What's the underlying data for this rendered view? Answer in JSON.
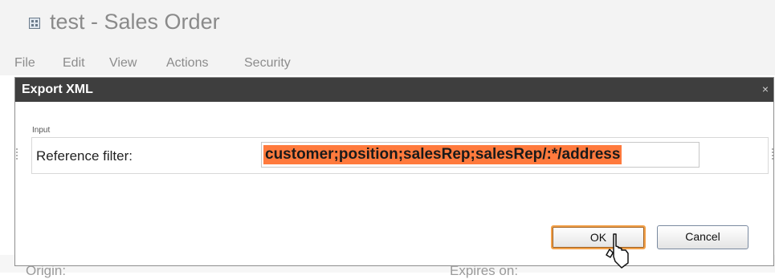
{
  "app": {
    "title": "test - Sales Order",
    "menu": [
      "File",
      "Edit",
      "View",
      "Actions",
      "Security"
    ],
    "background_labels": [
      "Origin:",
      "Expires on:"
    ]
  },
  "dialog": {
    "title": "Export XML",
    "close_glyph": "×",
    "group_label": "Input",
    "field_label": "Reference filter:",
    "field_value": "customer;position;salesRep;salesRep/:*/address",
    "ok_label": "OK",
    "cancel_label": "Cancel"
  },
  "colors": {
    "titlebar": "#3e3e3e",
    "selection_highlight": "#ff7a3d",
    "ok_focus": "#f2a14a"
  },
  "icons": [
    "form-icon",
    "close-icon",
    "mouse-pointer-icon"
  ]
}
